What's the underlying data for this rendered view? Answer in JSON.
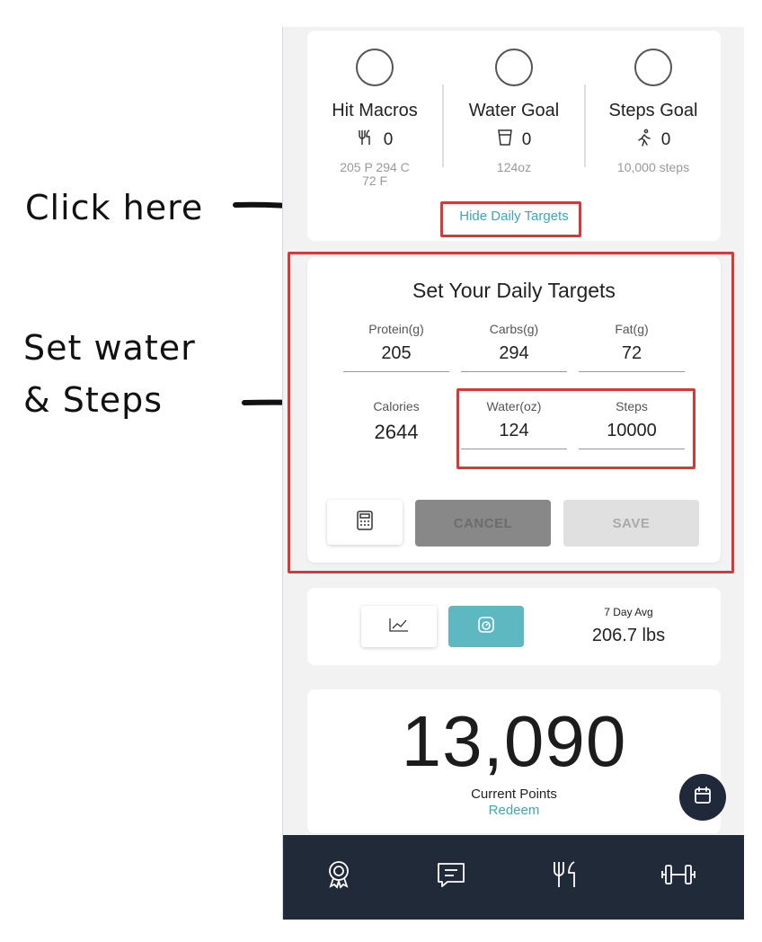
{
  "annotations": {
    "click_here": "Click here",
    "set_line1": "Set water",
    "set_line2": "& Steps"
  },
  "goals": {
    "macros": {
      "title": "Hit Macros",
      "value": "0",
      "sub": "205 P  294 C 72 F",
      "icon": "fork-knife-icon"
    },
    "water": {
      "title": "Water Goal",
      "value": "0",
      "sub": "124oz",
      "icon": "cup-icon"
    },
    "steps": {
      "title": "Steps Goal",
      "value": "0",
      "sub": "10,000 steps",
      "icon": "walking-icon"
    },
    "hide_link": "Hide Daily Targets"
  },
  "targets": {
    "title": "Set Your Daily Targets",
    "protein": {
      "label": "Protein(g)",
      "value": "205"
    },
    "carbs": {
      "label": "Carbs(g)",
      "value": "294"
    },
    "fat": {
      "label": "Fat(g)",
      "value": "72"
    },
    "calories": {
      "label": "Calories",
      "value": "2644"
    },
    "water": {
      "label": "Water(oz)",
      "value": "124"
    },
    "steps": {
      "label": "Steps",
      "value": "10000"
    },
    "cancel_label": "CANCEL",
    "save_label": "SAVE"
  },
  "weight": {
    "avg_label": "7 Day Avg",
    "avg_value": "206.7 lbs"
  },
  "points": {
    "value": "13,090",
    "label": "Current Points",
    "link": "Redeem"
  },
  "nav": {
    "items": [
      "badge-icon",
      "chat-icon",
      "fork-knife-icon",
      "dumbbell-icon"
    ]
  },
  "colors": {
    "accent": "#3fa6b6",
    "annotation_red": "#d63a38",
    "nav_bg": "#212a38"
  }
}
